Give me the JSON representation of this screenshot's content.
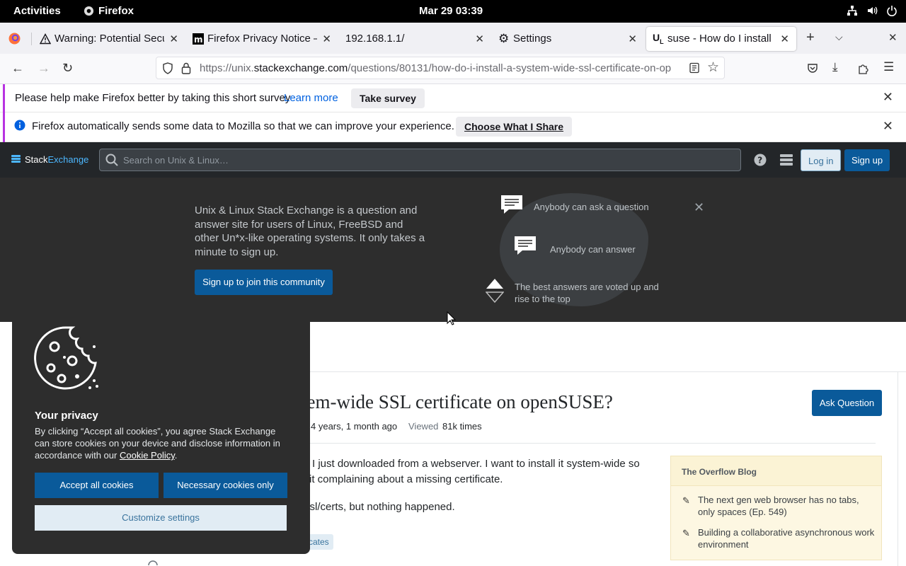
{
  "system_bar": {
    "activities": "Activities",
    "app": "Firefox",
    "clock": "Mar 29  03:39"
  },
  "tabs": [
    {
      "label": "Warning: Potential Secu"
    },
    {
      "label": "Firefox Privacy Notice —"
    },
    {
      "label": "192.168.1.1/"
    },
    {
      "label": "Settings"
    },
    {
      "label": "suse - How do I install a s"
    }
  ],
  "url": {
    "prefix": "https://unix.",
    "domain": "stackexchange.com",
    "path": "/questions/80131/how-do-i-install-a-system-wide-ssl-certificate-on-op"
  },
  "survey_bar": {
    "text": "Please help make Firefox better by taking this short survey",
    "link": "Learn more",
    "button": "Take survey"
  },
  "data_bar": {
    "text": "Firefox automatically sends some data to Mozilla so that we can improve your experience.",
    "button": "Choose What I Share"
  },
  "se_header": {
    "logo_a": "Stack",
    "logo_b": "Exchange",
    "search_placeholder": "Search on Unix & Linux…",
    "login": "Log in",
    "signup": "Sign up"
  },
  "hero": {
    "description": "Unix & Linux Stack Exchange is a question and answer site for users of Linux, FreeBSD and other Un*x-like operating systems. It only takes a minute to sign up.",
    "join": "Sign up to join this community",
    "feature_1": "Anybody can ask a question",
    "feature_2": "Anybody can answer",
    "feature_3": "The best answers are voted up and rise to the top"
  },
  "question": {
    "title_visible": "tem-wide SSL certificate on openSUSE?",
    "asked": "4 years, 1 month ago",
    "viewed_label": "Viewed",
    "viewed": "81k times",
    "line1": "I just downloaded from a webserver. I want to install it system-wide so",
    "line2": "it complaining about a missing certificate.",
    "line3": "ssl/certs, but nothing happened.",
    "tag": "cates",
    "ask_button": "Ask Question"
  },
  "blog": {
    "heading": "The Overflow Blog",
    "item1": "The next gen web browser has no tabs, only spaces (Ep. 549)",
    "item2": "Building a collaborative asynchronous work environment"
  },
  "cookie": {
    "title": "Your privacy",
    "text_a": "By clicking “Accept all cookies”, you agree Stack Exchange can store cookies on your device and disclose information in accordance with our",
    "policy": "Cookie Policy",
    "text_b": ".",
    "accept_all": "Accept all cookies",
    "necessary": "Necessary cookies only",
    "customize": "Customize settings"
  },
  "colors": {
    "accent_blue": "#0a5a9a",
    "header_dark": "#232629",
    "hero_bg": "#2d2d2d"
  }
}
